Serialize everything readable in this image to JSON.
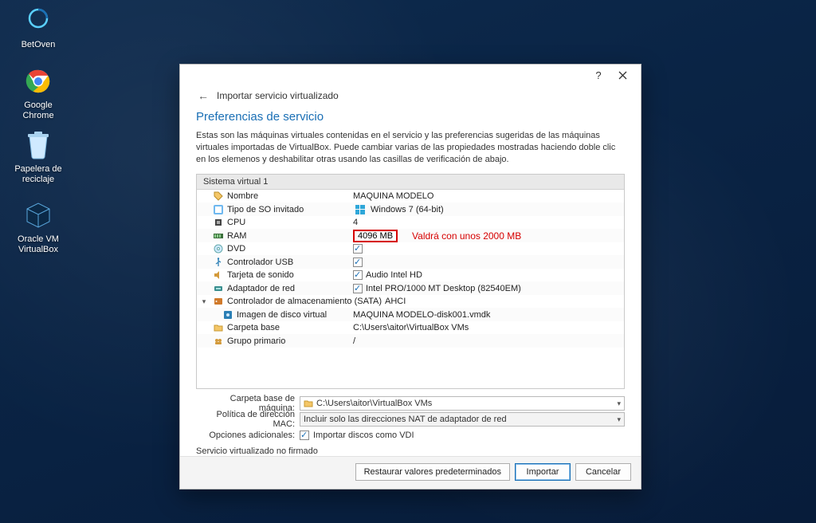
{
  "desktop": {
    "icons": [
      {
        "name": "betoven",
        "label": "BetOven"
      },
      {
        "name": "chrome",
        "label": "Google Chrome"
      },
      {
        "name": "recycle",
        "label": "Papelera de reciclaje"
      },
      {
        "name": "vbox",
        "label": "Oracle VM VirtualBox"
      }
    ]
  },
  "dialog": {
    "breadcrumb": "Importar servicio virtualizado",
    "section_title": "Preferencias de servicio",
    "description": "Estas son las máquinas virtuales contenidas en el servicio y las preferencias sugeridas de las máquinas virtuales importadas de VirtualBox. Puede cambiar varias de las propiedades mostradas haciendo doble clic en los elemenos y deshabilitar otras usando las casillas de verificación de abajo.",
    "group_header": "Sistema virtual 1",
    "rows": {
      "name": {
        "label": "Nombre",
        "value": "MAQUINA MODELO"
      },
      "os": {
        "label": "Tipo de SO invitado",
        "value": "Windows 7 (64-bit)"
      },
      "cpu": {
        "label": "CPU",
        "value": "4"
      },
      "ram": {
        "label": "RAM",
        "value": "4096 MB",
        "annotation": "Valdrá con unos 2000 MB"
      },
      "dvd": {
        "label": "DVD"
      },
      "usb": {
        "label": "Controlador USB"
      },
      "audio": {
        "label": "Tarjeta de sonido",
        "value": "Audio Intel HD"
      },
      "net": {
        "label": "Adaptador de red",
        "value": "Intel PRO/1000 MT Desktop (82540EM)"
      },
      "storage": {
        "label": "Controlador de almacenamiento (SATA)",
        "value": "AHCI"
      },
      "diskimg": {
        "label": "Imagen de disco virtual",
        "value": "MAQUINA MODELO-disk001.vmdk"
      },
      "basefolder": {
        "label": "Carpeta base",
        "value": "C:\\Users\\aitor\\VirtualBox VMs"
      },
      "group": {
        "label": "Grupo primario",
        "value": "/"
      }
    },
    "form": {
      "base_folder_label": "Carpeta base de máquina:",
      "base_folder_value": "C:\\Users\\aitor\\VirtualBox VMs",
      "mac_label": "Política de dirección MAC:",
      "mac_value": "Incluir solo las direcciones NAT de adaptador de red",
      "extra_label": "Opciones adicionales:",
      "extra_check_label": "Importar discos como VDI"
    },
    "unsigned": "Servicio virtualizado no firmado",
    "buttons": {
      "restore": "Restaurar valores predeterminados",
      "import": "Importar",
      "cancel": "Cancelar"
    }
  }
}
